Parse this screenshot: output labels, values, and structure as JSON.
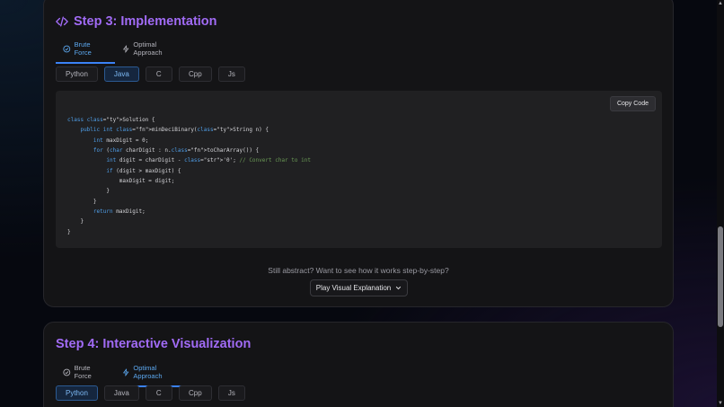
{
  "step3": {
    "title": "Step 3: Implementation",
    "tabs": [
      {
        "label": "Brute Force",
        "icon": "check-circle-icon",
        "active": true
      },
      {
        "label": "Optimal Approach",
        "icon": "zap-icon",
        "active": false
      }
    ],
    "languages": [
      {
        "label": "Python",
        "active": false
      },
      {
        "label": "Java",
        "active": true
      },
      {
        "label": "C",
        "active": false
      },
      {
        "label": "Cpp",
        "active": false
      },
      {
        "label": "Js",
        "active": false
      }
    ],
    "copy_label": "Copy Code",
    "code_lines": [
      "class Solution {",
      "    public int minDeciBinary(String n) {",
      "        int maxDigit = 0;",
      "        for (char charDigit : n.toCharArray()) {",
      "            int digit = charDigit - '0'; // Convert char to int",
      "            if (digit > maxDigit) {",
      "                maxDigit = digit;",
      "            }",
      "        }",
      "        return maxDigit;",
      "    }",
      "}"
    ],
    "hint_text": "Still abstract? Want to see how it works step-by-step?",
    "play_label": "Play Visual Explanation"
  },
  "step4": {
    "title": "Step 4: Interactive Visualization",
    "tabs": [
      {
        "label": "Brute Force",
        "icon": "check-circle-icon",
        "active": false
      },
      {
        "label": "Optimal Approach",
        "icon": "zap-icon",
        "active": true
      }
    ],
    "languages": [
      {
        "label": "Python",
        "active": true
      },
      {
        "label": "Java",
        "active": false
      },
      {
        "label": "C",
        "active": false
      },
      {
        "label": "Cpp",
        "active": false
      },
      {
        "label": "Js",
        "active": false
      }
    ]
  },
  "colors": {
    "accent_title": "#a16bf5",
    "active_tab": "#5ca8f0",
    "background": "#06080f"
  }
}
